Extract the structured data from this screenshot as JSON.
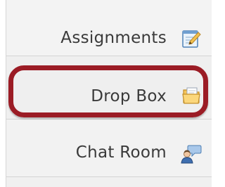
{
  "menu": {
    "items": [
      {
        "label": "Assignments",
        "icon": "assignment-edit-icon"
      },
      {
        "label": "Drop Box",
        "icon": "drop-box-folder-icon"
      },
      {
        "label": "Chat Room",
        "icon": "chat-room-user-icon"
      }
    ]
  },
  "colors": {
    "highlight": "#9b1c25",
    "menu_background": "#f2f2f2",
    "text": "#3a3a3a"
  }
}
